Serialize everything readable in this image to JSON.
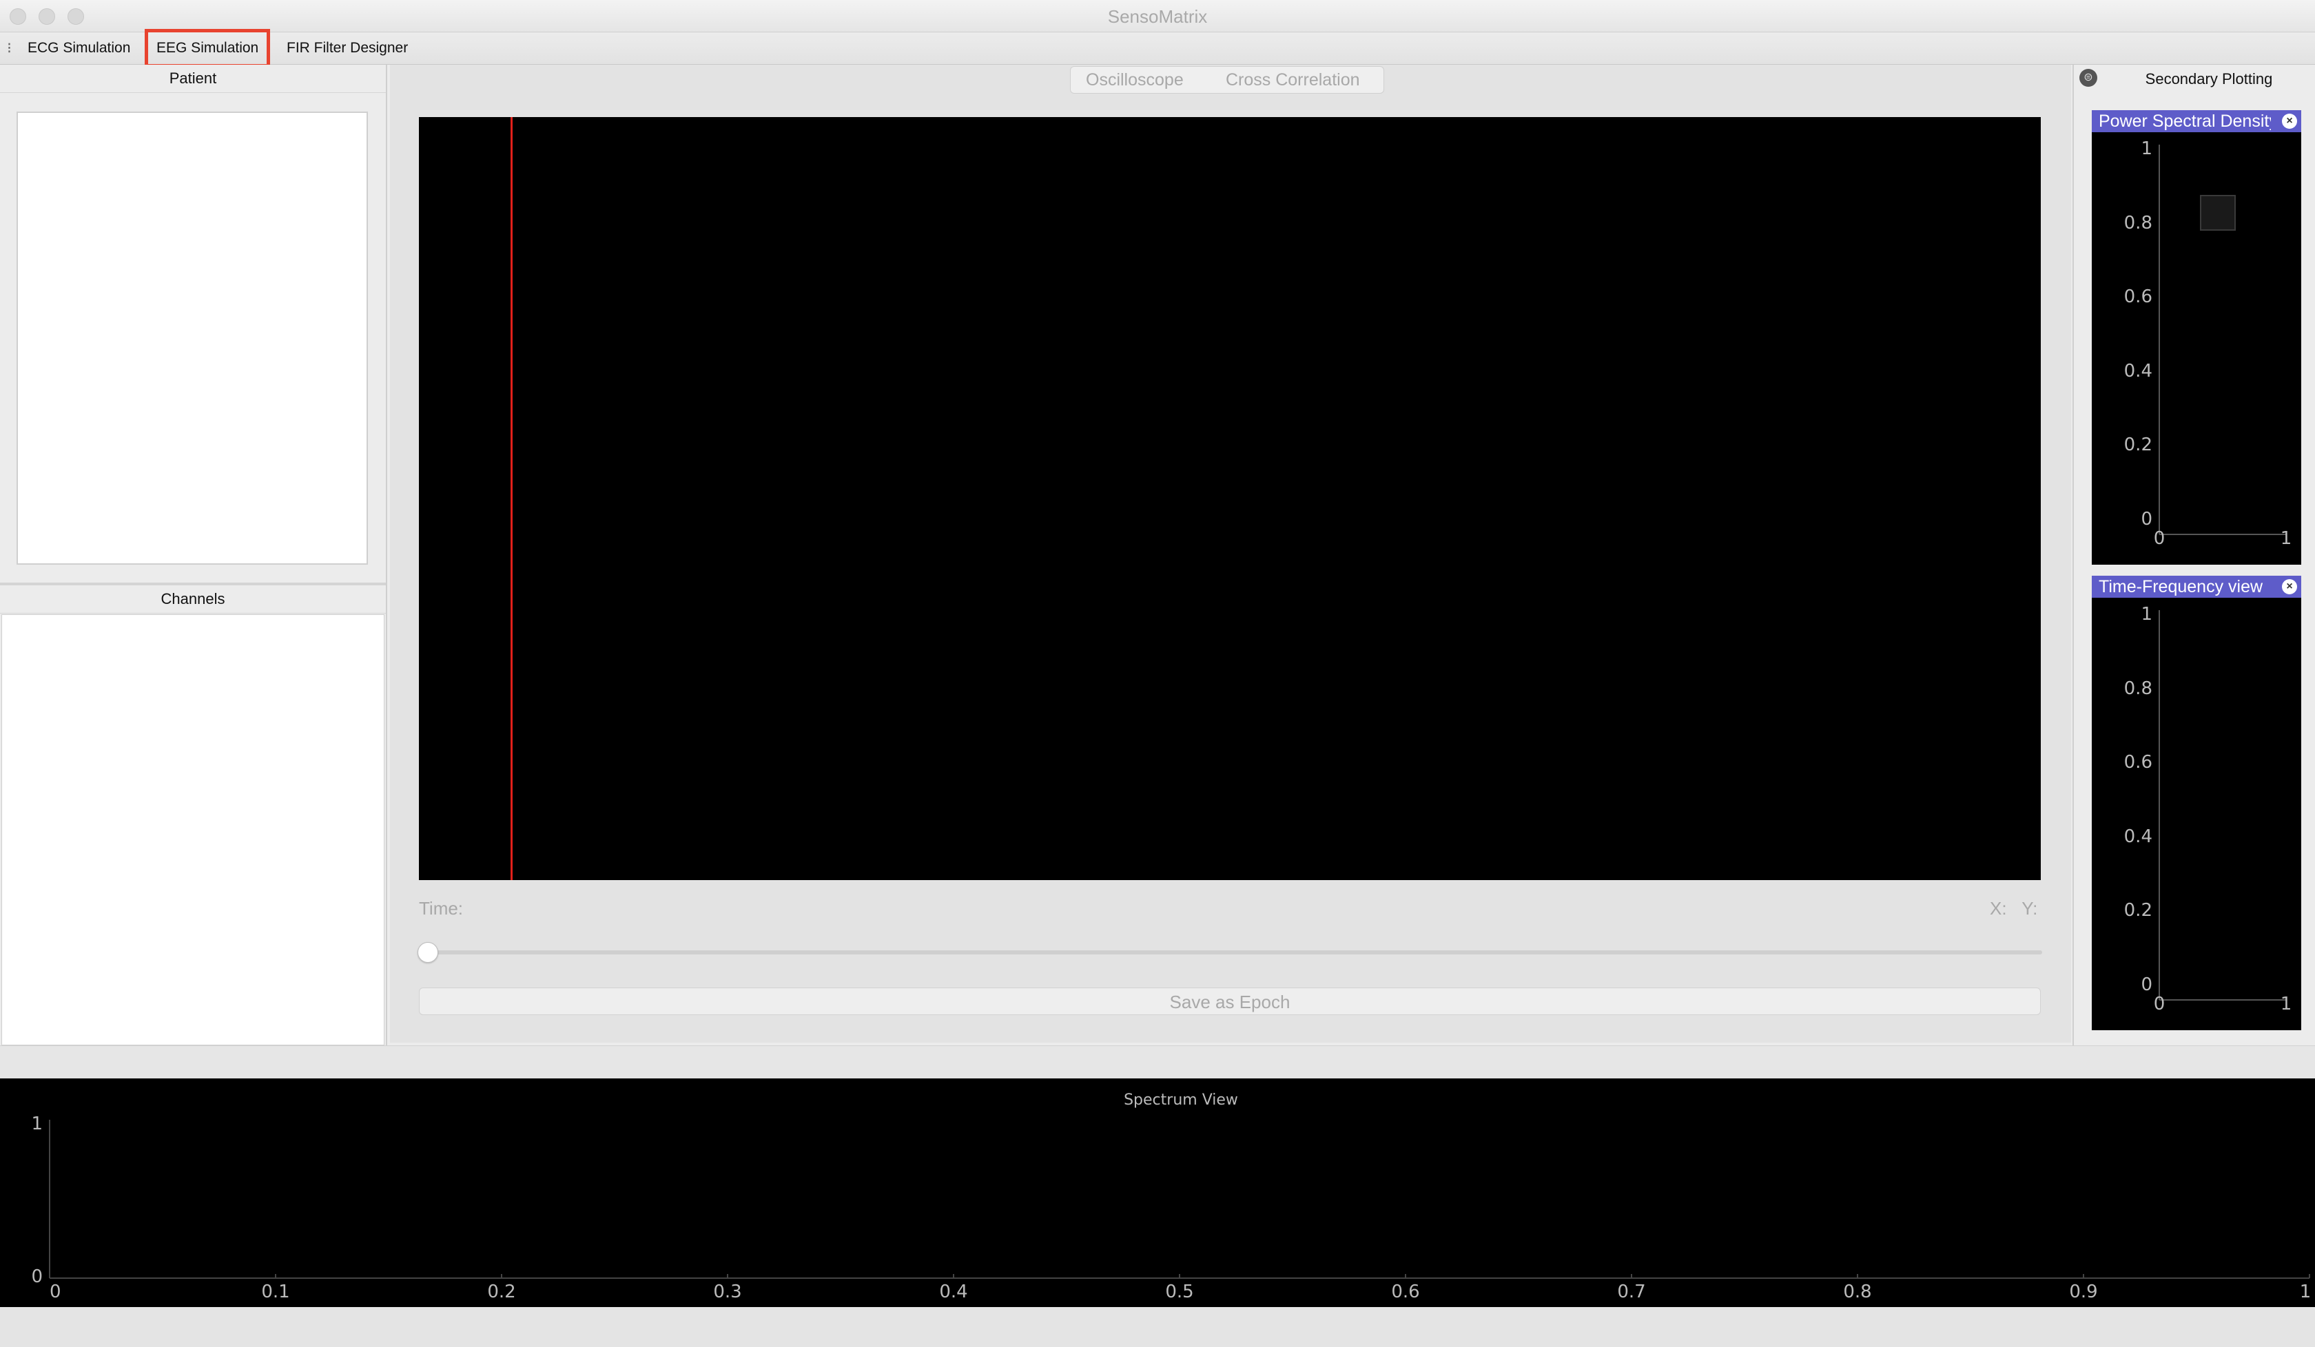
{
  "window": {
    "title": "SensoMatrix"
  },
  "tabs": [
    {
      "label": "ECG Simulation",
      "selected": false
    },
    {
      "label": "EEG Simulation",
      "selected": true
    },
    {
      "label": "FIR Filter Designer",
      "selected": false
    }
  ],
  "left_panel": {
    "patient_header": "Patient",
    "channels_header": "Channels"
  },
  "center": {
    "view_tabs": [
      "Oscilloscope",
      "Cross Correlation"
    ],
    "time_label": "Time:",
    "x_label": "X:",
    "y_label": "Y:",
    "save_epoch_label": "Save as Epoch",
    "cursor_color": "#e0201a"
  },
  "secondary": {
    "title": "Secondary Plotting",
    "plots": [
      {
        "title": "Power Spectral Density",
        "y_ticks": [
          "1",
          "0.8",
          "0.6",
          "0.4",
          "0.2",
          "0"
        ],
        "x_ticks": [
          "0",
          "1"
        ]
      },
      {
        "title": "Time-Frequency view",
        "y_ticks": [
          "1",
          "0.8",
          "0.6",
          "0.4",
          "0.2",
          "0"
        ],
        "x_ticks": [
          "0",
          "1"
        ]
      }
    ],
    "title_bar_color": "#5e5cc9"
  },
  "spectrum": {
    "title": "Spectrum View",
    "y_ticks": [
      "1",
      "0"
    ],
    "x_ticks": [
      "0",
      "0.1",
      "0.2",
      "0.3",
      "0.4",
      "0.5",
      "0.6",
      "0.7",
      "0.8",
      "0.9",
      "1"
    ]
  }
}
